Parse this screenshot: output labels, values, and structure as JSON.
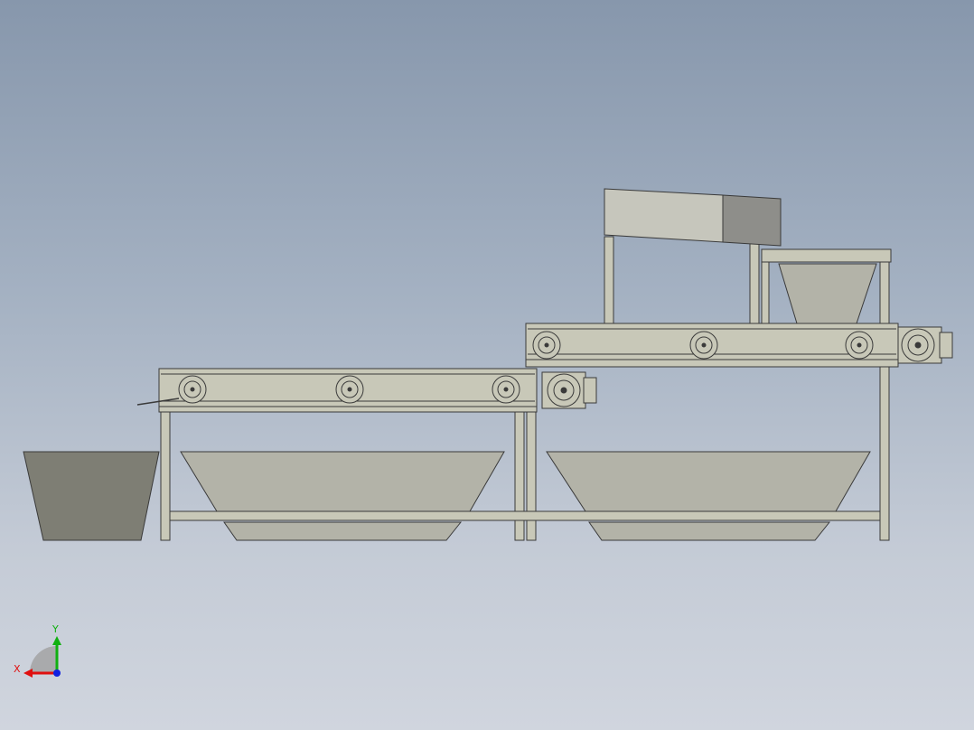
{
  "colors": {
    "background_top": "#8797ac",
    "background_bottom": "#d0d5de",
    "frame_fill": "#c8c8b8",
    "frame_stroke": "#3a3a3a",
    "hopper_fill": "#b3b3a8",
    "bin_fill": "#7e7e74",
    "box_fill": "#c6c6bc",
    "box_end_fill": "#8e8e8a",
    "axis_x": "#e01010",
    "axis_y": "#10b010",
    "axis_z": "#1020e0"
  },
  "triad": {
    "x_label": "X",
    "y_label": "Y"
  }
}
